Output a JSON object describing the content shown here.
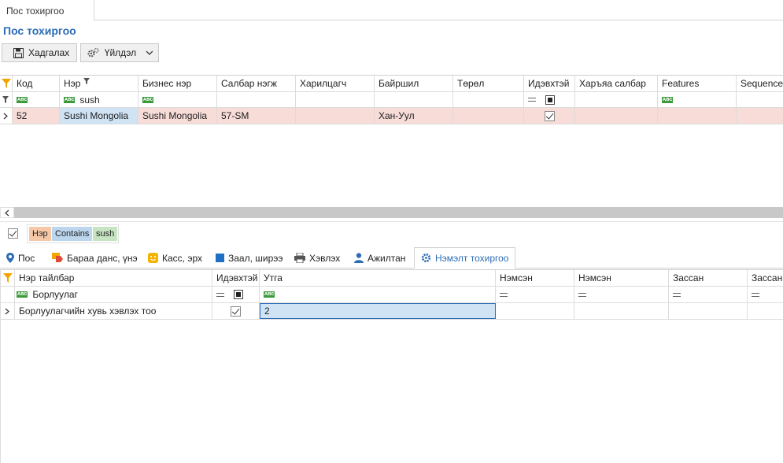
{
  "doc_tab": {
    "label": "Пос тохиргоо"
  },
  "page": {
    "title": "Пос тохиргоо"
  },
  "toolbar": {
    "save_label": "Хадгалах",
    "actions_label": "Үйлдэл"
  },
  "top_grid": {
    "columns": [
      "Код",
      "Нэр",
      "Бизнес нэр",
      "Салбар нэгж",
      "Харилцагч",
      "Байршил",
      "Төрөл",
      "Идэвхтэй",
      "Харъяа салбар",
      "Features",
      "SequenceI"
    ],
    "filter": {
      "name_value": "sush"
    },
    "rows": [
      {
        "code": "52",
        "name": "Sushi Mongolia",
        "business_name": "Sushi Mongolia",
        "branch": "57-SM",
        "customer": "",
        "location": "Хан-Уул",
        "type": "",
        "active": true,
        "parent_branch": "",
        "features": ""
      }
    ]
  },
  "filter_bar": {
    "field": "Нэр",
    "operator": "Contains",
    "value": "sush"
  },
  "sub_tabs": [
    "Пос",
    "Бараа данс, үнэ",
    "Касс, эрх",
    "Заал, ширээ",
    "Хэвлэх",
    "Ажилтан",
    "Нэмэлт тохиргоо"
  ],
  "bottom_grid": {
    "columns": [
      "Нэр тайлбар",
      "Идэвхтэй",
      "Утга",
      "Нэмсэн",
      "Нэмсэн",
      "Зассан",
      "Зассан"
    ],
    "filter": {
      "name_value": "Борлуулаг"
    },
    "rows": [
      {
        "name": "Борлуулагчийн хувь хэвлэх тоо",
        "active": true,
        "value": "2"
      }
    ]
  },
  "colors": {
    "accent": "#2d6db5",
    "selected_row": "#f7dcd8",
    "filter_chip_field": "#f5c9a8",
    "filter_chip_op": "#bcd6ee",
    "filter_chip_value": "#c6e4c2"
  }
}
